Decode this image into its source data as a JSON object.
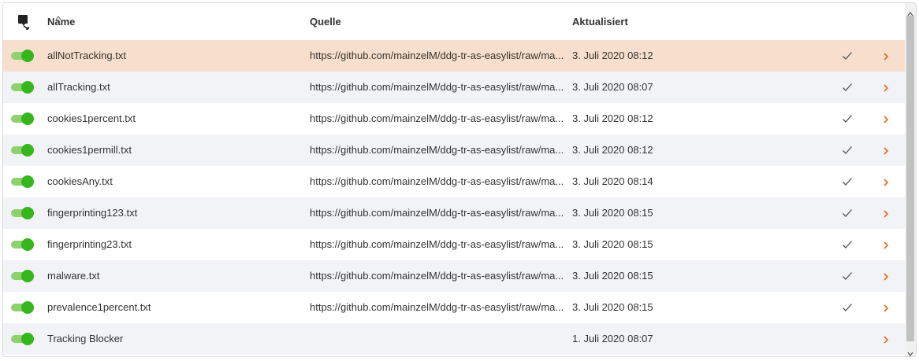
{
  "columns": {
    "name": "Name",
    "source": "Quelle",
    "updated": "Aktualisiert"
  },
  "icons": {
    "header": "filter-list-icon",
    "check": "checkmark-icon",
    "chevron": "chevron-right-icon",
    "sort": "sort-ascending-icon"
  },
  "colors": {
    "toggle_on": "#36b51c",
    "accent": "#e56a1a",
    "selected_row": "#f8dfcd"
  },
  "rows": [
    {
      "name": "allNotTracking.txt",
      "source": "https://github.com/mainzelM/ddg-tr-as-easylist/raw/ma...",
      "updated": "3. Juli 2020 08:12",
      "enabled": true,
      "checked": true
    },
    {
      "name": "allTracking.txt",
      "source": "https://github.com/mainzelM/ddg-tr-as-easylist/raw/ma...",
      "updated": "3. Juli 2020 08:07",
      "enabled": true,
      "checked": true
    },
    {
      "name": "cookies1percent.txt",
      "source": "https://github.com/mainzelM/ddg-tr-as-easylist/raw/ma...",
      "updated": "3. Juli 2020 08:12",
      "enabled": true,
      "checked": true
    },
    {
      "name": "cookies1permill.txt",
      "source": "https://github.com/mainzelM/ddg-tr-as-easylist/raw/ma...",
      "updated": "3. Juli 2020 08:12",
      "enabled": true,
      "checked": true
    },
    {
      "name": "cookiesAny.txt",
      "source": "https://github.com/mainzelM/ddg-tr-as-easylist/raw/ma...",
      "updated": "3. Juli 2020 08:14",
      "enabled": true,
      "checked": true
    },
    {
      "name": "fingerprinting123.txt",
      "source": "https://github.com/mainzelM/ddg-tr-as-easylist/raw/ma...",
      "updated": "3. Juli 2020 08:15",
      "enabled": true,
      "checked": true
    },
    {
      "name": "fingerprinting23.txt",
      "source": "https://github.com/mainzelM/ddg-tr-as-easylist/raw/ma...",
      "updated": "3. Juli 2020 08:15",
      "enabled": true,
      "checked": true
    },
    {
      "name": "malware.txt",
      "source": "https://github.com/mainzelM/ddg-tr-as-easylist/raw/ma...",
      "updated": "3. Juli 2020 08:15",
      "enabled": true,
      "checked": true
    },
    {
      "name": "prevalence1percent.txt",
      "source": "https://github.com/mainzelM/ddg-tr-as-easylist/raw/ma...",
      "updated": "3. Juli 2020 08:15",
      "enabled": true,
      "checked": true
    },
    {
      "name": "Tracking Blocker",
      "source": "",
      "updated": "1. Juli 2020 08:07",
      "enabled": true,
      "checked": false
    }
  ]
}
